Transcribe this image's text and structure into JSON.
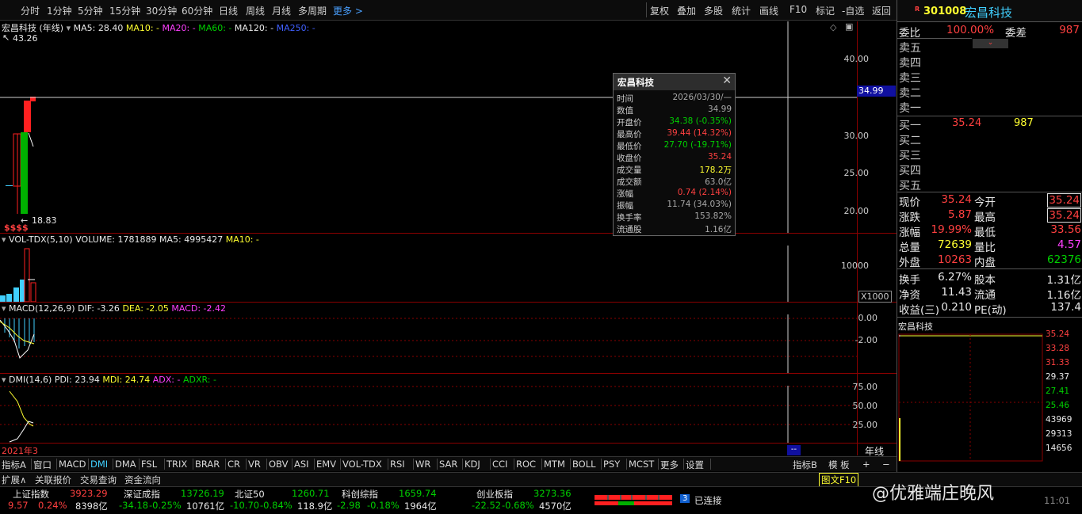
{
  "toolbar": {
    "periods": [
      "分时",
      "1分钟",
      "5分钟",
      "15分钟",
      "30分钟",
      "60分钟",
      "日线",
      "周线",
      "月线",
      "多周期",
      "更多 >"
    ],
    "tools": [
      "复权",
      "叠加",
      "多股",
      "统计",
      "画线",
      "F10",
      "标记",
      "-自选",
      "返回"
    ]
  },
  "main_panel": {
    "title": "宏昌科技 (年线)",
    "ma5": "MA5: 28.40",
    "ma10": "MA10: -",
    "ma20": "MA20: -",
    "ma60": "MA60: -",
    "ma120": "MA120: -",
    "ma250": "MA250: -",
    "high_mark": "43.26",
    "low_mark": "18.83",
    "current_price_tag": "34.99",
    "yticks": [
      "40.00",
      "35.00",
      "30.00",
      "25.00",
      "20.00"
    ],
    "dividend_marks": "$$$$"
  },
  "vol_panel": {
    "title": "VOL-TDX(5,10)",
    "volume": "VOLUME: 1781889",
    "ma5": "MA5: 4995427",
    "ma10": "MA10: -",
    "ytick": "10000",
    "unit": "X1000"
  },
  "macd_panel": {
    "title": "MACD(12,26,9)",
    "dif": "DIF: -3.26",
    "dea": "DEA: -2.05",
    "macd": "MACD: -2.42",
    "yticks": [
      "0.00",
      "-2.00"
    ]
  },
  "dmi_panel": {
    "title": "DMI(14,6)",
    "pdi": "PDI: 23.94",
    "mdi": "MDI: 24.74",
    "adx": "ADX: -",
    "adxr": "ADXR: -",
    "yticks": [
      "75.00",
      "50.00",
      "25.00"
    ]
  },
  "x_axis": {
    "start_label": "2021年3",
    "cursor_label": "--",
    "period_label": "年线"
  },
  "popup": {
    "title": "宏昌科技",
    "rows": [
      {
        "k": "时间",
        "v": "2026/03/30/—",
        "c": "gray"
      },
      {
        "k": "数值",
        "v": "34.99",
        "c": "gray"
      },
      {
        "k": "开盘价",
        "v": "34.38 (-0.35%)",
        "c": "green"
      },
      {
        "k": "最高价",
        "v": "39.44 (14.32%)",
        "c": "red"
      },
      {
        "k": "最低价",
        "v": "27.70 (-19.71%)",
        "c": "green"
      },
      {
        "k": "收盘价",
        "v": "35.24",
        "c": "red"
      },
      {
        "k": "成交量",
        "v": "178.2万",
        "c": "yellow"
      },
      {
        "k": "成交额",
        "v": "63.0亿",
        "c": "gray"
      },
      {
        "k": "涨幅",
        "v": "0.74 (2.14%)",
        "c": "red"
      },
      {
        "k": "振幅",
        "v": "11.74 (34.03%)",
        "c": "gray"
      },
      {
        "k": "换手率",
        "v": "153.82%",
        "c": "gray"
      },
      {
        "k": "流通股",
        "v": "1.16亿",
        "c": "gray"
      }
    ]
  },
  "quote": {
    "badge": "R",
    "code": "301008",
    "name": "宏昌科技",
    "weibi_label": "委比",
    "weibi": "100.00%",
    "weicha_label": "委差",
    "weicha": "987",
    "sells": [
      "卖五",
      "卖四",
      "卖三",
      "卖二",
      "卖一"
    ],
    "buys": [
      {
        "label": "买一",
        "price": "35.24",
        "vol": "987"
      },
      {
        "label": "买二",
        "price": "",
        "vol": ""
      },
      {
        "label": "买三",
        "price": "",
        "vol": ""
      },
      {
        "label": "买四",
        "price": "",
        "vol": ""
      },
      {
        "label": "买五",
        "price": "",
        "vol": ""
      }
    ],
    "stats": [
      {
        "l1": "现价",
        "v1": "35.24",
        "c1": "red",
        "l2": "今开",
        "v2": "35.24",
        "c2": "red",
        "box": true
      },
      {
        "l1": "涨跌",
        "v1": "5.87",
        "c1": "red",
        "l2": "最高",
        "v2": "35.24",
        "c2": "red",
        "box": true
      },
      {
        "l1": "涨幅",
        "v1": "19.99%",
        "c1": "red",
        "l2": "最低",
        "v2": "33.56",
        "c2": "red",
        "box": false
      },
      {
        "l1": "总量",
        "v1": "72639",
        "c1": "yellow",
        "l2": "量比",
        "v2": "4.57",
        "c2": "magenta",
        "box": false
      },
      {
        "l1": "外盘",
        "v1": "10263",
        "c1": "red",
        "l2": "内盘",
        "v2": "62376",
        "c2": "green",
        "box": false
      },
      {
        "l1": "换手",
        "v1": "6.27%",
        "c1": "white",
        "l2": "股本",
        "v2": "1.31亿",
        "c2": "white",
        "box": false
      },
      {
        "l1": "净资",
        "v1": "11.43",
        "c1": "white",
        "l2": "流通",
        "v2": "1.16亿",
        "c2": "white",
        "box": false
      },
      {
        "l1": "收益(三)",
        "v1": "0.210",
        "c1": "white",
        "l2": "PE(动)",
        "v2": "137.4",
        "c2": "white",
        "box": false
      }
    ],
    "mini_title": "宏昌科技",
    "mini_price_ticks": [
      "35.24",
      "33.28",
      "31.33",
      "29.37",
      "27.41",
      "25.46"
    ],
    "mini_vol_ticks": [
      "43969",
      "29313",
      "14656"
    ]
  },
  "indicator_tabs": [
    "指标A",
    "窗口",
    "MACD",
    "DMI",
    "DMA",
    "FSL",
    "TRIX",
    "BRAR",
    "CR",
    "VR",
    "OBV",
    "ASI",
    "EMV",
    "VOL-TDX",
    "RSI",
    "WR",
    "SAR",
    "KDJ",
    "CCI",
    "ROC",
    "MTM",
    "BOLL",
    "PSY",
    "MCST",
    "更多",
    "设置"
  ],
  "indicator_right": [
    "指标B",
    "模 板",
    "+",
    "−"
  ],
  "bottom_tabs": [
    "扩展∧",
    "关联报价",
    "交易查询",
    "资金流向"
  ],
  "bottom_right": "图文F10",
  "indices": [
    {
      "name": "上证指数",
      "price": "3923.29",
      "chg": "9.57",
      "pct": "0.24%",
      "amt": "8398亿",
      "c": "red"
    },
    {
      "name": "深证成指",
      "price": "13726.19",
      "chg": "-34.18",
      "pct": "-0.25%",
      "amt": "10761亿",
      "c": "green"
    },
    {
      "name": "北证50",
      "price": "1260.71",
      "chg": "-10.70",
      "pct": "-0.84%",
      "amt": "118.9亿",
      "c": "green"
    },
    {
      "name": "科创综指",
      "price": "1659.74",
      "chg": "-2.98",
      "pct": "-0.18%",
      "amt": "1964亿",
      "c": "green"
    },
    {
      "name": "创业板指",
      "price": "3273.36",
      "chg": "-22.52",
      "pct": "-0.68%",
      "amt": "4570亿",
      "c": "green"
    }
  ],
  "connection": {
    "count": "3",
    "label": "已连接"
  },
  "watermark": "@优雅端庄晚风",
  "time_partial": "11:01"
}
